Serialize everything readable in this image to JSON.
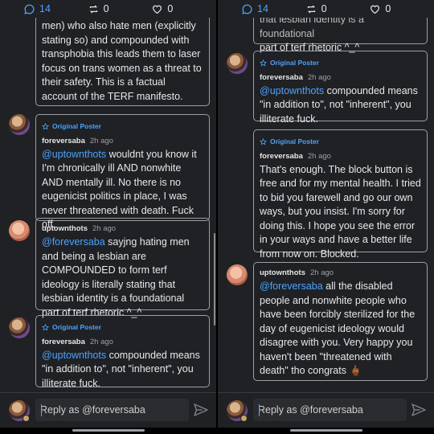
{
  "stats": {
    "comments": "14",
    "reblogs": "0",
    "likes": "0"
  },
  "op_badge": "Original Poster",
  "reply_placeholder": "Reply as @foreversaba",
  "left": {
    "c0_body": "men) who also hate men (explicitly stating so) and compounded with transphobia this leads them to laser focus on trans women as a threat to their safety. This is a factual account of the TERF manifesto.",
    "c1": {
      "user": "foreversaba",
      "time": "2h ago",
      "mention": "@uptownthots",
      "body": " wouldnt you know it I'm chronically ill AND nonwhite AND mentally ill. No there is no eugenicist politics in place, I was never threatened with death. Fuck off."
    },
    "c2": {
      "user": "uptownthots",
      "time": "2h ago",
      "mention": "@foreversaba",
      "body": " sayjng hating men and being a lesbian are COMPOUNDED to form terf ideology is literally stating that lesbian identity is a foundational part of terf rhetoric ^_^"
    },
    "c3": {
      "user": "foreversaba",
      "time": "2h ago",
      "mention": "@uptownthots",
      "body": " compounded means \"in addition to\", not \"inherent\", you illiterate fuck."
    }
  },
  "right": {
    "c0_partial": "that lesbian identity is a foundational",
    "c0_body": "part of terf rhetoric ^_^",
    "c1": {
      "user": "foreversaba",
      "time": "2h ago",
      "mention": "@uptownthots",
      "body": " compounded means \"in addition to\", not \"inherent\", you illiterate fuck."
    },
    "c2": {
      "user": "foreversaba",
      "time": "2h ago",
      "body": "That's enough. The block button is free and for my mental health. I tried to bid you farewell and go our own ways, but you insist. I'm sorry for doing this. I hope you see the error in your ways and have a better life from now on. Blocked."
    },
    "c3": {
      "user": "uptownthots",
      "time": "2h ago",
      "mention": "@foreversaba",
      "body": " all the disabled people and nonwhite people who have been forcibly sterilized for the day of eugenicist ideology would disagree with you. Very happy you haven't been \"threatened with death\" tho congrats 🖕🏾"
    }
  },
  "colors": {
    "accent": "#4aa3ff",
    "background": "#202124",
    "border": "#9aa0a6"
  },
  "icons": [
    "comment-icon",
    "reblog-icon",
    "heart-icon",
    "star-icon",
    "send-icon"
  ]
}
